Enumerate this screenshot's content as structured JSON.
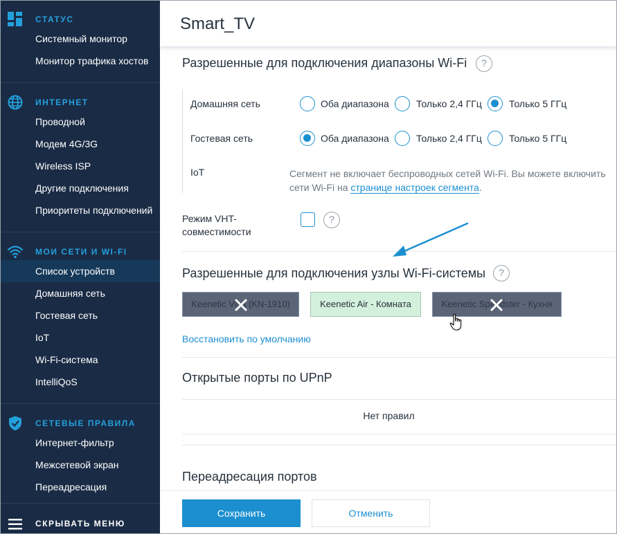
{
  "sidebar": {
    "sections": [
      {
        "title": "СТАТУС",
        "icon": "dashboard-icon",
        "items": [
          "Системный монитор",
          "Монитор трафика хостов"
        ]
      },
      {
        "title": "ИНТЕРНЕТ",
        "icon": "globe-icon",
        "items": [
          "Проводной",
          "Модем 4G/3G",
          "Wireless ISP",
          "Другие подключения",
          "Приоритеты подключений"
        ]
      },
      {
        "title": "МОИ СЕТИ И WI-FI",
        "icon": "wifi-icon",
        "items": [
          "Список устройств",
          "Домашняя сеть",
          "Гостевая сеть",
          "IoT",
          "Wi-Fi-система",
          "IntelliQoS"
        ],
        "active_item": "Список устройств"
      },
      {
        "title": "СЕТЕВЫЕ ПРАВИЛА",
        "icon": "shield-icon",
        "items": [
          "Интернет-фильтр",
          "Межсетевой экран",
          "Переадресация"
        ]
      }
    ],
    "collapse_label": "СКРЫВАТЬ МЕНЮ"
  },
  "page": {
    "title": "Smart_TV",
    "wifi_bands": {
      "heading": "Разрешенные для подключения диапазоны Wi-Fi",
      "option_labels": [
        "Оба диапазона",
        "Только 2,4 ГГц",
        "Только 5 ГГц"
      ],
      "rows": [
        {
          "label": "Домашняя сеть",
          "selected": "Только 5 ГГц"
        },
        {
          "label": "Гостевая сеть",
          "selected": "Оба диапазона"
        }
      ],
      "iot": {
        "label": "IoT",
        "note_text": "Сегмент не включает беспроводных сетей Wi-Fi. Вы можете включить сети Wi-Fi на ",
        "note_link": "странице настроек сегмента",
        "note_end": "."
      }
    },
    "vht": {
      "label": "Режим VHT-совместимости",
      "checked": false
    },
    "mesh_nodes": {
      "heading": "Разрешенные для подключения узлы Wi-Fi-системы",
      "nodes": [
        {
          "name": "Keenetic Viva (KN-1910)",
          "enabled": false
        },
        {
          "name": "Keenetic Air - Комната",
          "enabled": true
        },
        {
          "name": "Keenetic Speedster - Кухня",
          "enabled": false
        }
      ],
      "restore_label": "Восстановить по умолчанию"
    },
    "upnp": {
      "heading": "Открытые порты по UPnP",
      "empty_text": "Нет правил"
    },
    "port_forwarding": {
      "heading": "Переадресация портов"
    },
    "footer": {
      "save_label": "Сохранить",
      "cancel_label": "Отменить"
    }
  },
  "colors": {
    "sidebar_bg": "#1a2b45",
    "accent": "#1c8fd0",
    "section_title": "#23a0dc",
    "chip_disabled": "#5b6577",
    "chip_enabled": "#d3f0dc"
  }
}
